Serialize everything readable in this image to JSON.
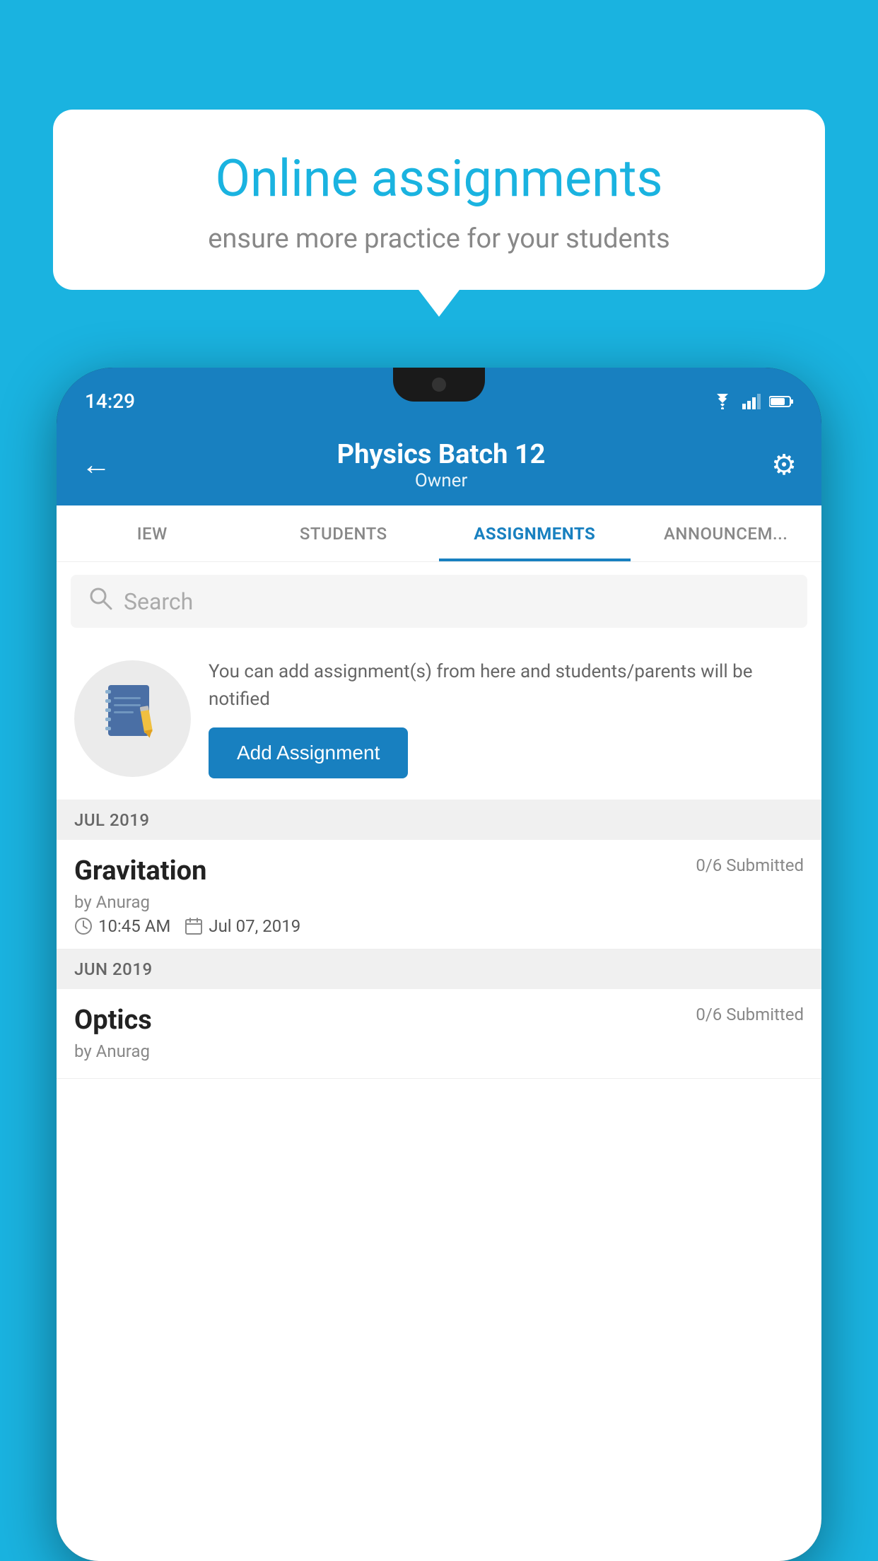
{
  "background_color": "#1ab3e0",
  "speech_bubble": {
    "title": "Online assignments",
    "subtitle": "ensure more practice for your students"
  },
  "phone": {
    "status_bar": {
      "time": "14:29"
    },
    "header": {
      "title": "Physics Batch 12",
      "subtitle": "Owner",
      "back_label": "←",
      "settings_label": "⚙"
    },
    "tabs": [
      {
        "label": "IEW",
        "active": false
      },
      {
        "label": "STUDENTS",
        "active": false
      },
      {
        "label": "ASSIGNMENTS",
        "active": true
      },
      {
        "label": "ANNOUNCEM...",
        "active": false
      }
    ],
    "search": {
      "placeholder": "Search"
    },
    "promo": {
      "text": "You can add assignment(s) from here and students/parents will be notified",
      "button_label": "Add Assignment"
    },
    "sections": [
      {
        "month_label": "JUL 2019",
        "assignments": [
          {
            "name": "Gravitation",
            "submitted": "0/6 Submitted",
            "by": "by Anurag",
            "time": "10:45 AM",
            "date": "Jul 07, 2019"
          }
        ]
      },
      {
        "month_label": "JUN 2019",
        "assignments": [
          {
            "name": "Optics",
            "submitted": "0/6 Submitted",
            "by": "by Anurag",
            "time": "",
            "date": ""
          }
        ]
      }
    ]
  }
}
